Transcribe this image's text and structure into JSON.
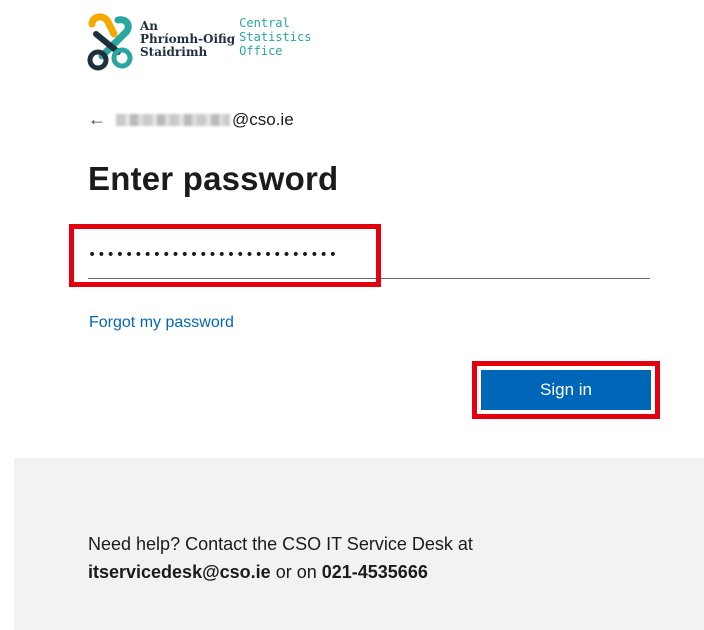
{
  "logo": {
    "irish_lines": [
      "An",
      "Phríomh-Oifig",
      "Staidrimh"
    ],
    "english_lines": [
      "Central",
      "Statistics",
      "Office"
    ],
    "colors": {
      "teal": "#2aa6a0",
      "yellow": "#f5a800",
      "navy": "#1f2f3d"
    }
  },
  "identity": {
    "back_icon": "arrow-left-icon",
    "email_suffix": "@cso.ie"
  },
  "title": "Enter password",
  "password": {
    "masked_value": "•••••••••••••••••••••••••••"
  },
  "forgot_link": "Forgot my password",
  "signin_label": "Sign in",
  "help": {
    "line1": "Need help? Contact the CSO IT Service Desk at",
    "email": "itservicedesk@cso.ie",
    "or_on": "or on",
    "phone": "021-4535666"
  },
  "colors": {
    "accent": "#0067b8",
    "highlight": "#e3000f",
    "footer_bg": "#f2f2f2"
  }
}
